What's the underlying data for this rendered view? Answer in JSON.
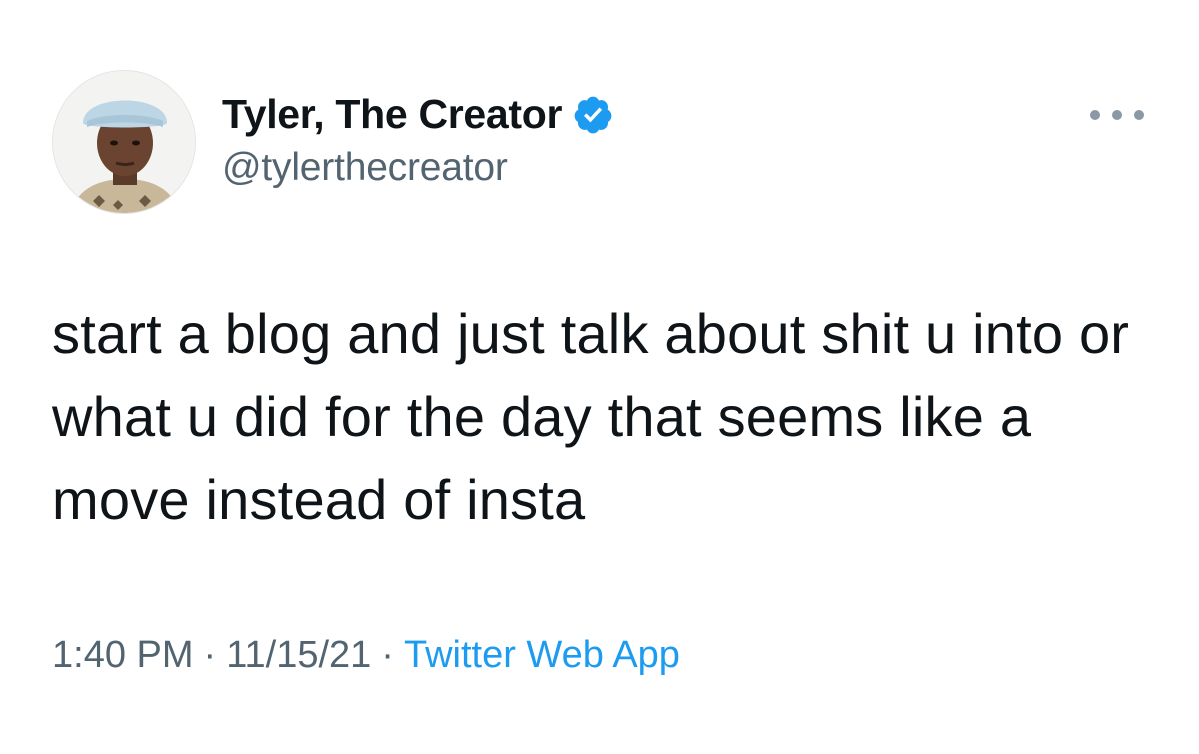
{
  "author": {
    "display_name": "Tyler, The Creator",
    "handle": "@tylerthecreator",
    "verified": true,
    "avatar_icon": "profile-photo"
  },
  "tweet": {
    "text": "start a blog and just talk about shit u into or what u did for the day that seems like a move instead of insta"
  },
  "meta": {
    "time": "1:40 PM",
    "separator": "·",
    "date": "11/15/21",
    "source": "Twitter Web App"
  },
  "icons": {
    "more": "more-options-icon",
    "verified": "verified-badge-icon"
  },
  "colors": {
    "text": "#0f1419",
    "secondary": "#536471",
    "accent": "#1d9bf0"
  }
}
